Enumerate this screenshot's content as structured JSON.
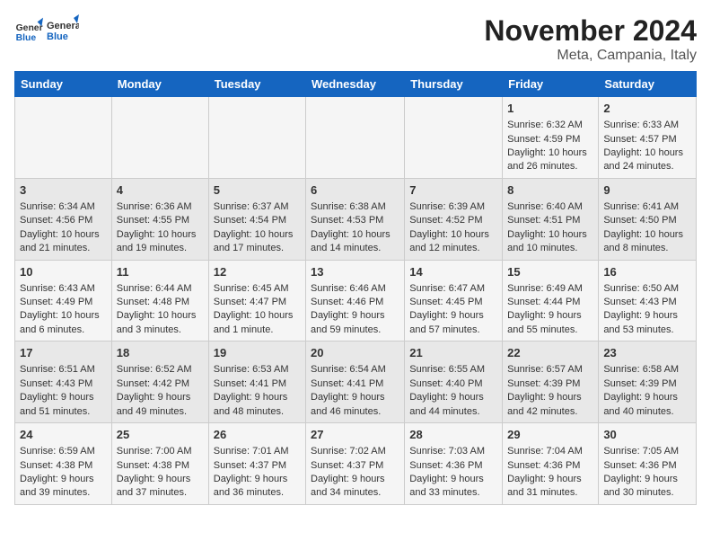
{
  "logo": {
    "general": "General",
    "blue": "Blue"
  },
  "title": "November 2024",
  "subtitle": "Meta, Campania, Italy",
  "weekdays": [
    "Sunday",
    "Monday",
    "Tuesday",
    "Wednesday",
    "Thursday",
    "Friday",
    "Saturday"
  ],
  "weeks": [
    [
      {
        "day": "",
        "info": ""
      },
      {
        "day": "",
        "info": ""
      },
      {
        "day": "",
        "info": ""
      },
      {
        "day": "",
        "info": ""
      },
      {
        "day": "",
        "info": ""
      },
      {
        "day": "1",
        "info": "Sunrise: 6:32 AM\nSunset: 4:59 PM\nDaylight: 10 hours and 26 minutes."
      },
      {
        "day": "2",
        "info": "Sunrise: 6:33 AM\nSunset: 4:57 PM\nDaylight: 10 hours and 24 minutes."
      }
    ],
    [
      {
        "day": "3",
        "info": "Sunrise: 6:34 AM\nSunset: 4:56 PM\nDaylight: 10 hours and 21 minutes."
      },
      {
        "day": "4",
        "info": "Sunrise: 6:36 AM\nSunset: 4:55 PM\nDaylight: 10 hours and 19 minutes."
      },
      {
        "day": "5",
        "info": "Sunrise: 6:37 AM\nSunset: 4:54 PM\nDaylight: 10 hours and 17 minutes."
      },
      {
        "day": "6",
        "info": "Sunrise: 6:38 AM\nSunset: 4:53 PM\nDaylight: 10 hours and 14 minutes."
      },
      {
        "day": "7",
        "info": "Sunrise: 6:39 AM\nSunset: 4:52 PM\nDaylight: 10 hours and 12 minutes."
      },
      {
        "day": "8",
        "info": "Sunrise: 6:40 AM\nSunset: 4:51 PM\nDaylight: 10 hours and 10 minutes."
      },
      {
        "day": "9",
        "info": "Sunrise: 6:41 AM\nSunset: 4:50 PM\nDaylight: 10 hours and 8 minutes."
      }
    ],
    [
      {
        "day": "10",
        "info": "Sunrise: 6:43 AM\nSunset: 4:49 PM\nDaylight: 10 hours and 6 minutes."
      },
      {
        "day": "11",
        "info": "Sunrise: 6:44 AM\nSunset: 4:48 PM\nDaylight: 10 hours and 3 minutes."
      },
      {
        "day": "12",
        "info": "Sunrise: 6:45 AM\nSunset: 4:47 PM\nDaylight: 10 hours and 1 minute."
      },
      {
        "day": "13",
        "info": "Sunrise: 6:46 AM\nSunset: 4:46 PM\nDaylight: 9 hours and 59 minutes."
      },
      {
        "day": "14",
        "info": "Sunrise: 6:47 AM\nSunset: 4:45 PM\nDaylight: 9 hours and 57 minutes."
      },
      {
        "day": "15",
        "info": "Sunrise: 6:49 AM\nSunset: 4:44 PM\nDaylight: 9 hours and 55 minutes."
      },
      {
        "day": "16",
        "info": "Sunrise: 6:50 AM\nSunset: 4:43 PM\nDaylight: 9 hours and 53 minutes."
      }
    ],
    [
      {
        "day": "17",
        "info": "Sunrise: 6:51 AM\nSunset: 4:43 PM\nDaylight: 9 hours and 51 minutes."
      },
      {
        "day": "18",
        "info": "Sunrise: 6:52 AM\nSunset: 4:42 PM\nDaylight: 9 hours and 49 minutes."
      },
      {
        "day": "19",
        "info": "Sunrise: 6:53 AM\nSunset: 4:41 PM\nDaylight: 9 hours and 48 minutes."
      },
      {
        "day": "20",
        "info": "Sunrise: 6:54 AM\nSunset: 4:41 PM\nDaylight: 9 hours and 46 minutes."
      },
      {
        "day": "21",
        "info": "Sunrise: 6:55 AM\nSunset: 4:40 PM\nDaylight: 9 hours and 44 minutes."
      },
      {
        "day": "22",
        "info": "Sunrise: 6:57 AM\nSunset: 4:39 PM\nDaylight: 9 hours and 42 minutes."
      },
      {
        "day": "23",
        "info": "Sunrise: 6:58 AM\nSunset: 4:39 PM\nDaylight: 9 hours and 40 minutes."
      }
    ],
    [
      {
        "day": "24",
        "info": "Sunrise: 6:59 AM\nSunset: 4:38 PM\nDaylight: 9 hours and 39 minutes."
      },
      {
        "day": "25",
        "info": "Sunrise: 7:00 AM\nSunset: 4:38 PM\nDaylight: 9 hours and 37 minutes."
      },
      {
        "day": "26",
        "info": "Sunrise: 7:01 AM\nSunset: 4:37 PM\nDaylight: 9 hours and 36 minutes."
      },
      {
        "day": "27",
        "info": "Sunrise: 7:02 AM\nSunset: 4:37 PM\nDaylight: 9 hours and 34 minutes."
      },
      {
        "day": "28",
        "info": "Sunrise: 7:03 AM\nSunset: 4:36 PM\nDaylight: 9 hours and 33 minutes."
      },
      {
        "day": "29",
        "info": "Sunrise: 7:04 AM\nSunset: 4:36 PM\nDaylight: 9 hours and 31 minutes."
      },
      {
        "day": "30",
        "info": "Sunrise: 7:05 AM\nSunset: 4:36 PM\nDaylight: 9 hours and 30 minutes."
      }
    ]
  ]
}
